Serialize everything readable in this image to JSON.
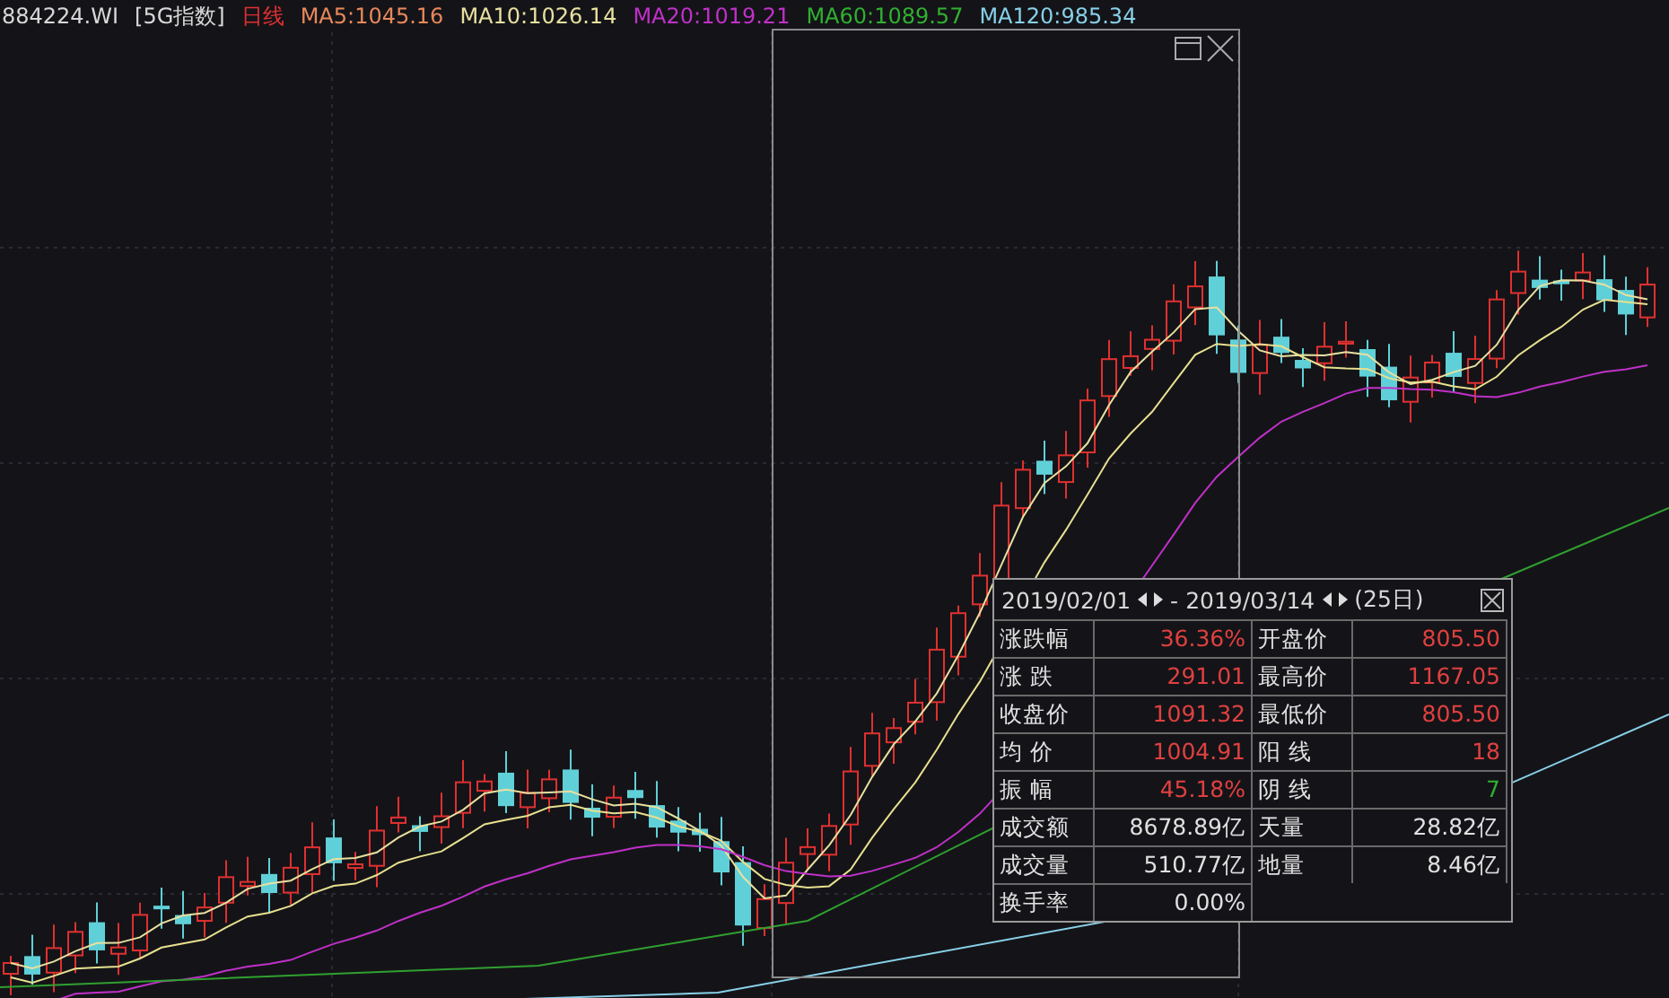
{
  "header": [
    {
      "text": "884224.WI",
      "color": "#d8d8d8"
    },
    {
      "text": "[5G指数]",
      "color": "#d8d8d8"
    },
    {
      "text": "日线",
      "color": "#e03030"
    },
    {
      "text": "MA5:1045.16",
      "color": "#e8875a"
    },
    {
      "text": "MA10:1026.14",
      "color": "#e8e0a0"
    },
    {
      "text": "MA20:1019.21",
      "color": "#c030c8"
    },
    {
      "text": "MA60:1089.57",
      "color": "#30b030"
    },
    {
      "text": "MA120:985.34",
      "color": "#88d0e8"
    }
  ],
  "stats_panel": {
    "start_date": "2019/02/01",
    "end_date": "2019/03/14",
    "separator": "-",
    "days": "(25日)",
    "rows": [
      {
        "cells": [
          {
            "label": "涨跌幅",
            "value": "36.36%",
            "kind": "rise"
          },
          {
            "label": "开盘价",
            "value": "805.50",
            "kind": "rise"
          }
        ]
      },
      {
        "cells": [
          {
            "label": "涨 跌",
            "value": "291.01",
            "kind": "rise"
          },
          {
            "label": "最高价",
            "value": "1167.05",
            "kind": "rise"
          }
        ]
      },
      {
        "cells": [
          {
            "label": "收盘价",
            "value": "1091.32",
            "kind": "rise"
          },
          {
            "label": "最低价",
            "value": "805.50",
            "kind": "rise"
          }
        ]
      },
      {
        "cells": [
          {
            "label": "均 价",
            "value": "1004.91",
            "kind": "rise"
          },
          {
            "label": "阳 线",
            "value": "18",
            "kind": "rise"
          }
        ]
      },
      {
        "cells": [
          {
            "label": "振 幅",
            "value": "45.18%",
            "kind": "rise"
          },
          {
            "label": "阴 线",
            "value": "7",
            "kind": "fall"
          }
        ]
      },
      {
        "cells": [
          {
            "label": "成交额",
            "value": "8678.89亿",
            "kind": "plain"
          },
          {
            "label": "天量",
            "value": "28.82亿",
            "kind": "plain"
          }
        ]
      },
      {
        "cells": [
          {
            "label": "成交量",
            "value": "510.77亿",
            "kind": "plain"
          },
          {
            "label": "地量",
            "value": "8.46亿",
            "kind": "plain"
          }
        ]
      },
      {
        "cells": [
          {
            "label": "换手率",
            "value": "0.00%",
            "kind": "plain"
          }
        ]
      }
    ]
  }
}
